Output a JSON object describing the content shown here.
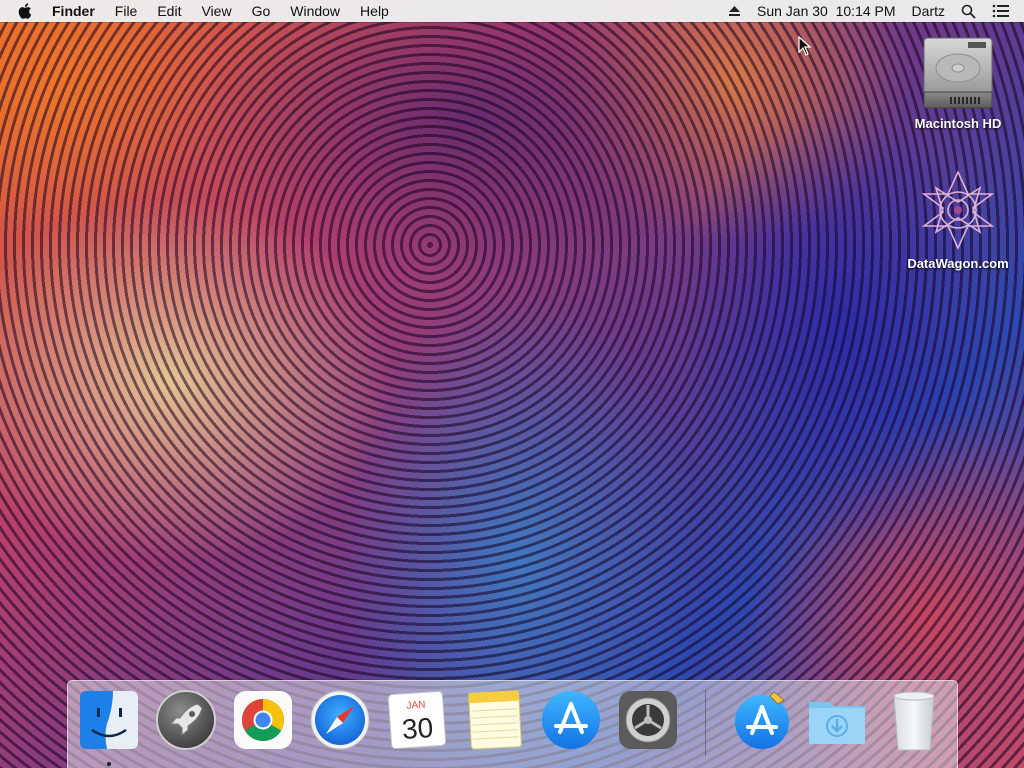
{
  "menubar": {
    "apple_icon": "apple-logo-icon",
    "app_name": "Finder",
    "menus": [
      "File",
      "Edit",
      "View",
      "Go",
      "Window",
      "Help"
    ],
    "status": {
      "eject_icon": "eject-icon",
      "clock": "Sun Jan 30  10:14 PM",
      "user": "Dartz",
      "search_icon": "spotlight-search-icon",
      "notifications_icon": "notification-center-icon"
    }
  },
  "desktop": {
    "icons": [
      {
        "label": "Macintosh HD",
        "icon": "hard-drive-icon"
      },
      {
        "label": "DataWagon.com",
        "icon": "datawagon-logo-icon"
      }
    ]
  },
  "dock": {
    "items": [
      {
        "name": "Finder",
        "icon": "finder-icon",
        "running": true
      },
      {
        "name": "Launchpad",
        "icon": "launchpad-rocket-icon",
        "running": false
      },
      {
        "name": "Google Chrome",
        "icon": "chrome-icon",
        "running": false
      },
      {
        "name": "Safari",
        "icon": "safari-compass-icon",
        "running": false
      },
      {
        "name": "Calendar",
        "icon": "calendar-icon",
        "running": false,
        "month": "JAN",
        "day": "30"
      },
      {
        "name": "Notes",
        "icon": "notes-icon",
        "running": false
      },
      {
        "name": "App Store",
        "icon": "app-store-icon",
        "running": false
      },
      {
        "name": "System Preferences",
        "icon": "system-preferences-gear-icon",
        "running": false
      },
      {
        "name": "App Store Installer",
        "icon": "app-store-installer-icon",
        "running": false
      },
      {
        "name": "Downloads",
        "icon": "downloads-folder-icon",
        "running": false
      },
      {
        "name": "Trash",
        "icon": "trash-icon",
        "running": false
      }
    ]
  },
  "colors": {
    "menubar_bg": "#eeeeee",
    "app_store_blue": "#1f8ff0",
    "chrome_red": "#db4437",
    "chrome_yellow": "#f4c20d",
    "chrome_green": "#0f9d58",
    "chrome_blue": "#4285f4"
  }
}
